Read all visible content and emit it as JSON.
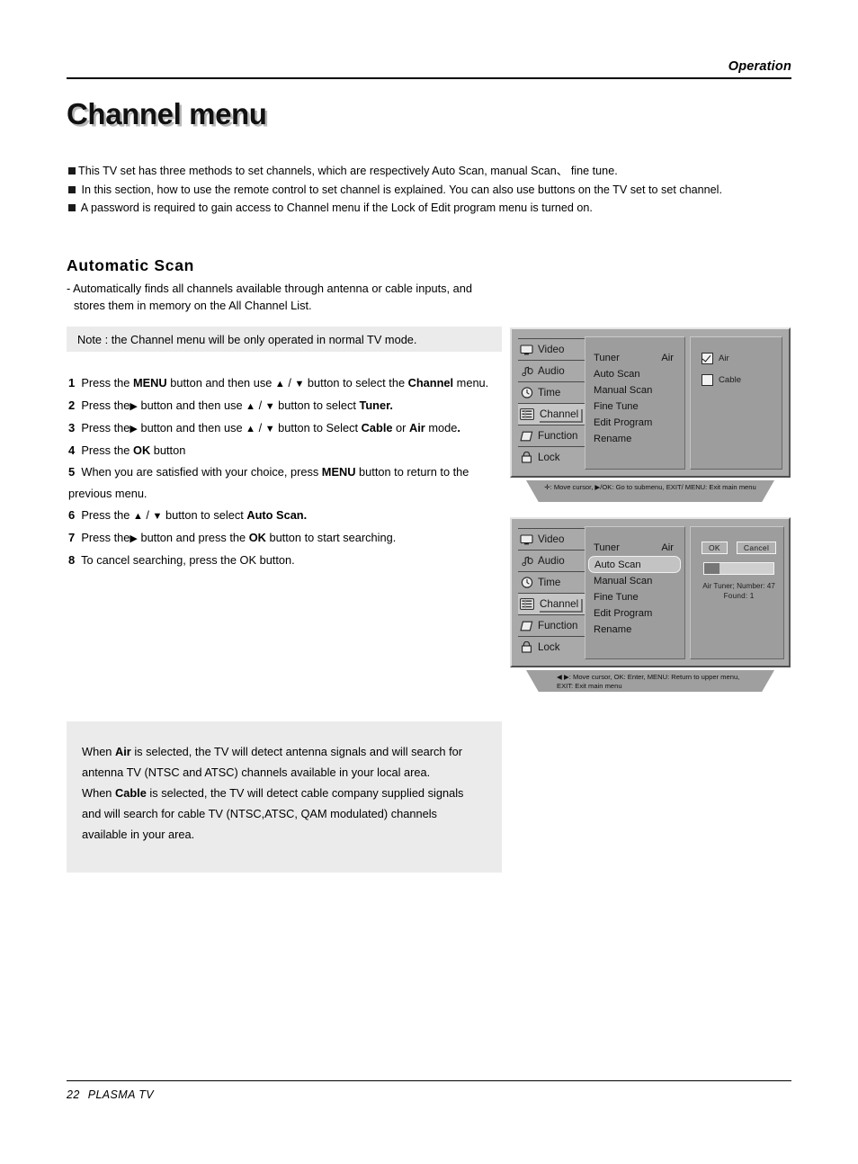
{
  "header": {
    "running_head": "Operation"
  },
  "title": "Channel menu",
  "intro": {
    "b1": "This TV set has three methods to set channels, which are respectively Auto Scan,  manual Scan、 fine tune.",
    "b2": " In this section, how to use the remote control  to set channel is explained. You can also use buttons on the TV set to set channel.",
    "b3": " A password is required to gain access to Channel menu if the Lock of Edit program menu is turned on."
  },
  "section": {
    "heading": "Automatic Scan",
    "desc_line1": "- Automatically finds all channels available through antenna or cable inputs, and",
    "desc_line2": "stores them in memory on the All Channel List.",
    "note": "Note : the Channel menu will be only operated  in normal TV mode."
  },
  "steps": [
    {
      "num": "1",
      "html": "Press the <b>MENU</b> button and then use <span class=\"arr\">▲</span> / <span class=\"arr\">▼</span> button to select the <b>Channel</b> menu."
    },
    {
      "num": "2",
      "html": "Press the<span class=\"arr\">▶</span> button and then use <span class=\"arr\">▲</span> / <span class=\"arr\">▼</span> button to select <b>Tuner.</b>"
    },
    {
      "num": "3",
      "html": "Press the<span class=\"arr\">▶</span> button and then use <span class=\"arr\">▲</span> / <span class=\"arr\">▼</span> button to Select <b>Cable</b> or <b>Air</b>  mode<b>.</b>"
    },
    {
      "num": "4",
      "html": "Press the <b>OK</b> button"
    },
    {
      "num": "5",
      "html": "When you are satisfied with your choice,  press <b>MENU</b> button to return to the previous menu."
    },
    {
      "num": "6",
      "html": "Press the <span class=\"arr\">▲</span> / <span class=\"arr\">▼</span> button to select <b>Auto Scan.</b>"
    },
    {
      "num": "7",
      "html": "Press the<span class=\"arr\">▶</span> button and press the <b>OK</b> button to start searching."
    },
    {
      "num": "8",
      "html": "To cancel searching, press the OK button."
    }
  ],
  "explain": {
    "p1_a": "When ",
    "p1_b": "Air",
    "p1_c": " is selected, the TV will detect antenna signals and will search for antenna TV (NTSC and ATSC) channels available in your local area.",
    "p2_a": "When ",
    "p2_b": "Cable",
    "p2_c": " is selected, the TV will detect cable company supplied signals and will search for cable TV (NTSC,ATSC, QAM modulated) channels available in your area."
  },
  "osd1": {
    "nav": [
      {
        "label": "Video",
        "icon": "monitor-icon",
        "selected": false
      },
      {
        "label": "Audio",
        "icon": "music-note-icon",
        "selected": false
      },
      {
        "label": "Time",
        "icon": "clock-icon",
        "selected": false
      },
      {
        "label": "Channel",
        "icon": "channel-list-icon",
        "selected": true
      },
      {
        "label": "Function",
        "icon": "diamond-icon",
        "selected": false
      },
      {
        "label": "Lock",
        "icon": "padlock-icon",
        "selected": false
      }
    ],
    "menu": [
      {
        "label": "Tuner",
        "value": "Air",
        "highlight": false
      },
      {
        "label": "Auto Scan",
        "value": "",
        "highlight": false
      },
      {
        "label": "Manual Scan",
        "value": "",
        "highlight": false
      },
      {
        "label": "Fine Tune",
        "value": "",
        "highlight": false
      },
      {
        "label": "Edit Program",
        "value": "",
        "highlight": false
      },
      {
        "label": "Rename",
        "value": "",
        "highlight": false
      }
    ],
    "options": [
      {
        "label": "Air",
        "checked": true
      },
      {
        "label": "Cable",
        "checked": false
      }
    ],
    "help": "✛: Move cursor,  ▶/OK: Go to submenu, EXIT/ MENU: Exit main menu"
  },
  "osd2": {
    "nav": [
      {
        "label": "Video",
        "icon": "monitor-icon",
        "selected": false
      },
      {
        "label": "Audio",
        "icon": "music-note-icon",
        "selected": false
      },
      {
        "label": "Time",
        "icon": "clock-icon",
        "selected": false
      },
      {
        "label": "Channel",
        "icon": "channel-list-icon",
        "selected": true
      },
      {
        "label": "Function",
        "icon": "diamond-icon",
        "selected": false
      },
      {
        "label": "Lock",
        "icon": "padlock-icon",
        "selected": false
      }
    ],
    "menu": [
      {
        "label": "Tuner",
        "value": "Air",
        "highlight": false
      },
      {
        "label": "Auto Scan",
        "value": "",
        "highlight": true
      },
      {
        "label": "Manual Scan",
        "value": "",
        "highlight": false
      },
      {
        "label": "Fine Tune",
        "value": "",
        "highlight": false
      },
      {
        "label": "Edit Program",
        "value": "",
        "highlight": false
      },
      {
        "label": "Rename",
        "value": "",
        "highlight": false
      }
    ],
    "buttons": {
      "ok": "OK",
      "cancel": "Cancel"
    },
    "progress_percent": 22,
    "status_line1": "Air Tuner;  Number: 47",
    "status_line2": "Found:         1",
    "help_line1": "◀ ▶: Move cursor,   OK: Enter, MENU: Return to upper menu,",
    "help_line2": "EXIT: Exit main menu"
  },
  "footer": {
    "page": "22",
    "product": "PLASMA TV"
  }
}
